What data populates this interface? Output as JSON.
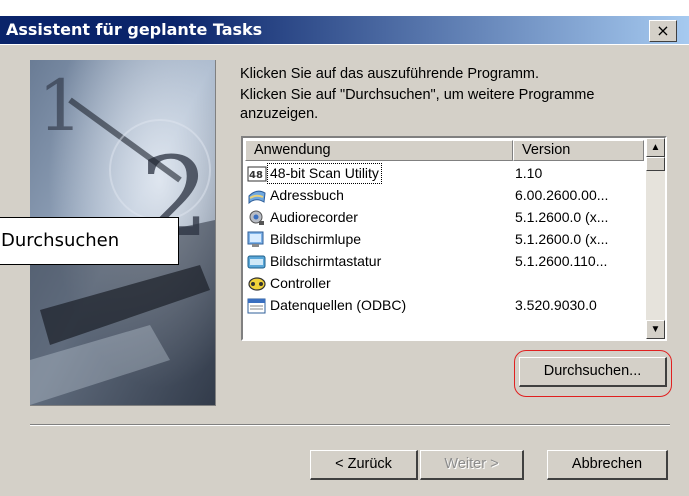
{
  "window": {
    "title": "Assistent für geplante Tasks",
    "close_glyph": "×",
    "title_colors": [
      "#0a246a",
      "#a6caf0"
    ]
  },
  "instructions": {
    "line1": "Klicken Sie auf das auszuführende Programm.",
    "line2": "Klicken Sie auf \"Durchsuchen\", um weitere Programme",
    "line3": "anzuzeigen."
  },
  "list": {
    "columns": [
      "Anwendung",
      "Version"
    ],
    "rows": [
      {
        "name": "48-bit Scan Utility",
        "version": "1.10",
        "icon": "scanner-icon"
      },
      {
        "name": "Adressbuch",
        "version": "6.00.2600.00...",
        "icon": "address-book-icon"
      },
      {
        "name": "Audiorecorder",
        "version": "5.1.2600.0 (x...",
        "icon": "audio-recorder-icon"
      },
      {
        "name": "Bildschirmlupe",
        "version": "5.1.2600.0 (x...",
        "icon": "magnifier-icon"
      },
      {
        "name": "Bildschirmtastatur",
        "version": "5.1.2600.110...",
        "icon": "keyboard-icon"
      },
      {
        "name": "Controller",
        "version": "",
        "icon": "controller-icon"
      },
      {
        "name": "Datenquellen (ODBC)",
        "version": "3.520.9030.0",
        "icon": "odbc-icon"
      }
    ]
  },
  "buttons": {
    "browse": "Durchsuchen...",
    "back": "< Zurück",
    "next": "Weiter >",
    "cancel": "Abbrechen"
  },
  "tooltip": {
    "text": "Durchsuchen"
  },
  "accent": {
    "highlight_color": "#e02020"
  }
}
